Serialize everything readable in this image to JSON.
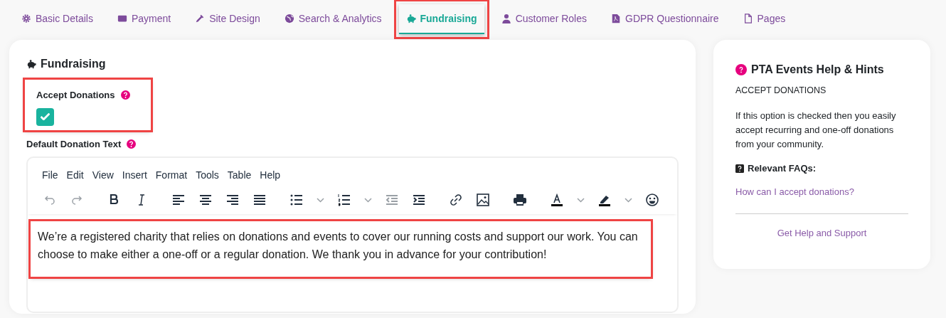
{
  "tabs": [
    {
      "label": "Basic Details",
      "kind": "gear",
      "selected": false,
      "highlighted": false
    },
    {
      "label": "Payment",
      "kind": "card",
      "selected": false,
      "highlighted": false
    },
    {
      "label": "Site Design",
      "kind": "dropper",
      "selected": false,
      "highlighted": false
    },
    {
      "label": "Search & Analytics",
      "kind": "globe",
      "selected": false,
      "highlighted": false
    },
    {
      "label": "Fundraising",
      "kind": "piggy",
      "selected": true,
      "highlighted": true
    },
    {
      "label": "Customer Roles",
      "kind": "user",
      "selected": false,
      "highlighted": false
    },
    {
      "label": "GDPR Questionnaire",
      "kind": "pdf",
      "selected": false,
      "highlighted": false
    },
    {
      "label": "Pages",
      "kind": "file",
      "selected": false,
      "highlighted": false
    }
  ],
  "form": {
    "title": "Fundraising",
    "accept_donations": {
      "label": "Accept Donations",
      "checked": true,
      "highlighted": true
    },
    "donation_text": {
      "label": "Default Donation Text",
      "menu": [
        "File",
        "Edit",
        "View",
        "Insert",
        "Format",
        "Tools",
        "Table",
        "Help"
      ],
      "toolbar": [
        [
          {
            "kind": "undo",
            "disabled": true
          },
          {
            "kind": "redo",
            "disabled": true
          }
        ],
        [
          {
            "kind": "bold",
            "disabled": false
          },
          {
            "kind": "italic",
            "disabled": false
          }
        ],
        [
          {
            "kind": "align-left",
            "disabled": false
          },
          {
            "kind": "align-center",
            "disabled": false
          },
          {
            "kind": "align-right",
            "disabled": false
          },
          {
            "kind": "justify",
            "disabled": false
          }
        ],
        [
          {
            "kind": "bullets",
            "disabled": false
          },
          {
            "kind": "caret",
            "disabled": false
          },
          {
            "kind": "numbers",
            "disabled": false
          },
          {
            "kind": "caret",
            "disabled": false
          },
          {
            "kind": "outdent",
            "disabled": true
          },
          {
            "kind": "indent",
            "disabled": false
          }
        ],
        [
          {
            "kind": "link",
            "disabled": false
          },
          {
            "kind": "image",
            "disabled": false
          }
        ],
        [
          {
            "kind": "print",
            "disabled": false
          }
        ],
        [
          {
            "kind": "text-color",
            "disabled": false
          },
          {
            "kind": "caret",
            "disabled": false
          },
          {
            "kind": "highlight",
            "disabled": false
          },
          {
            "kind": "caret",
            "disabled": false
          },
          {
            "kind": "emoji",
            "disabled": false
          }
        ]
      ],
      "content": "We’re a registered charity that relies on donations and events to cover our running costs and support our work. You can choose to make either a one-off or a regular donation. We thank you in advance for your contribution!",
      "highlighted": true
    }
  },
  "help": {
    "title": "PTA Events Help & Hints",
    "topic": "ACCEPT DONATIONS",
    "text": "If this option is checked then you easily accept recurring and one-off donations from your community.",
    "faq_heading": "Relevant FAQs:",
    "faqs": [
      "How can I accept donations?"
    ],
    "support_link": "Get Help and Support"
  }
}
